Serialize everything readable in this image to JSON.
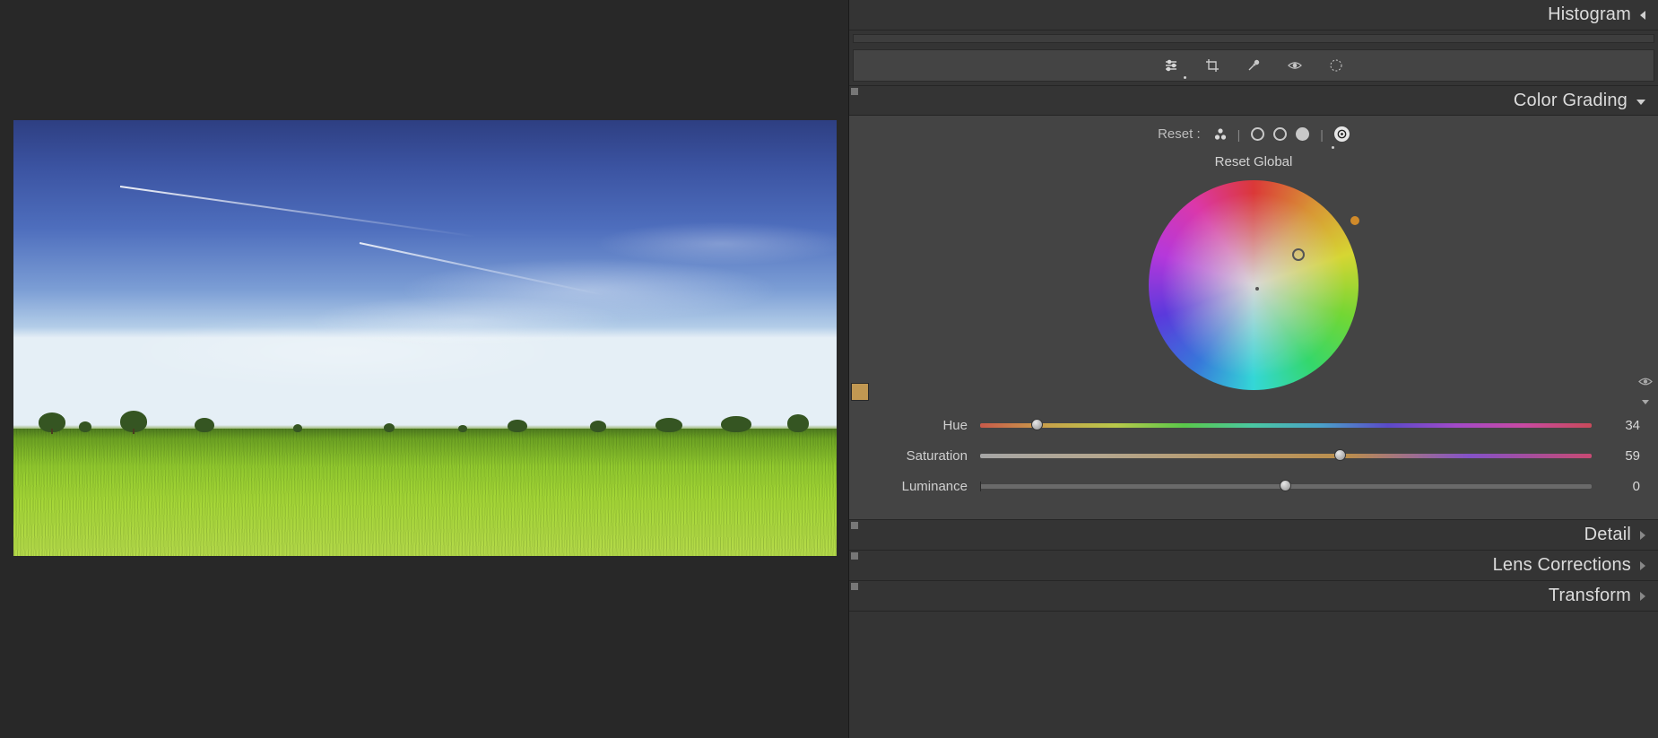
{
  "panels": {
    "histogram": {
      "title": "Histogram"
    },
    "color_grading": {
      "title": "Color Grading",
      "reset_label": "Reset :",
      "hint": "Reset Global",
      "selected_mode": "global",
      "swatch_color": "#c19852",
      "sliders": {
        "hue": {
          "label": "Hue",
          "value": 34,
          "min": 0,
          "max": 360
        },
        "saturation": {
          "label": "Saturation",
          "value": 59,
          "min": 0,
          "max": 100
        },
        "luminance": {
          "label": "Luminance",
          "value": 0,
          "min": -100,
          "max": 100
        }
      }
    },
    "detail": {
      "title": "Detail"
    },
    "lens_corrections": {
      "title": "Lens Corrections"
    },
    "transform": {
      "title": "Transform"
    }
  },
  "toolstrip": {
    "tools": [
      "sliders-icon",
      "crop-icon",
      "eyedropper-icon",
      "eye-icon",
      "radial-icon"
    ],
    "active_index": 0
  }
}
